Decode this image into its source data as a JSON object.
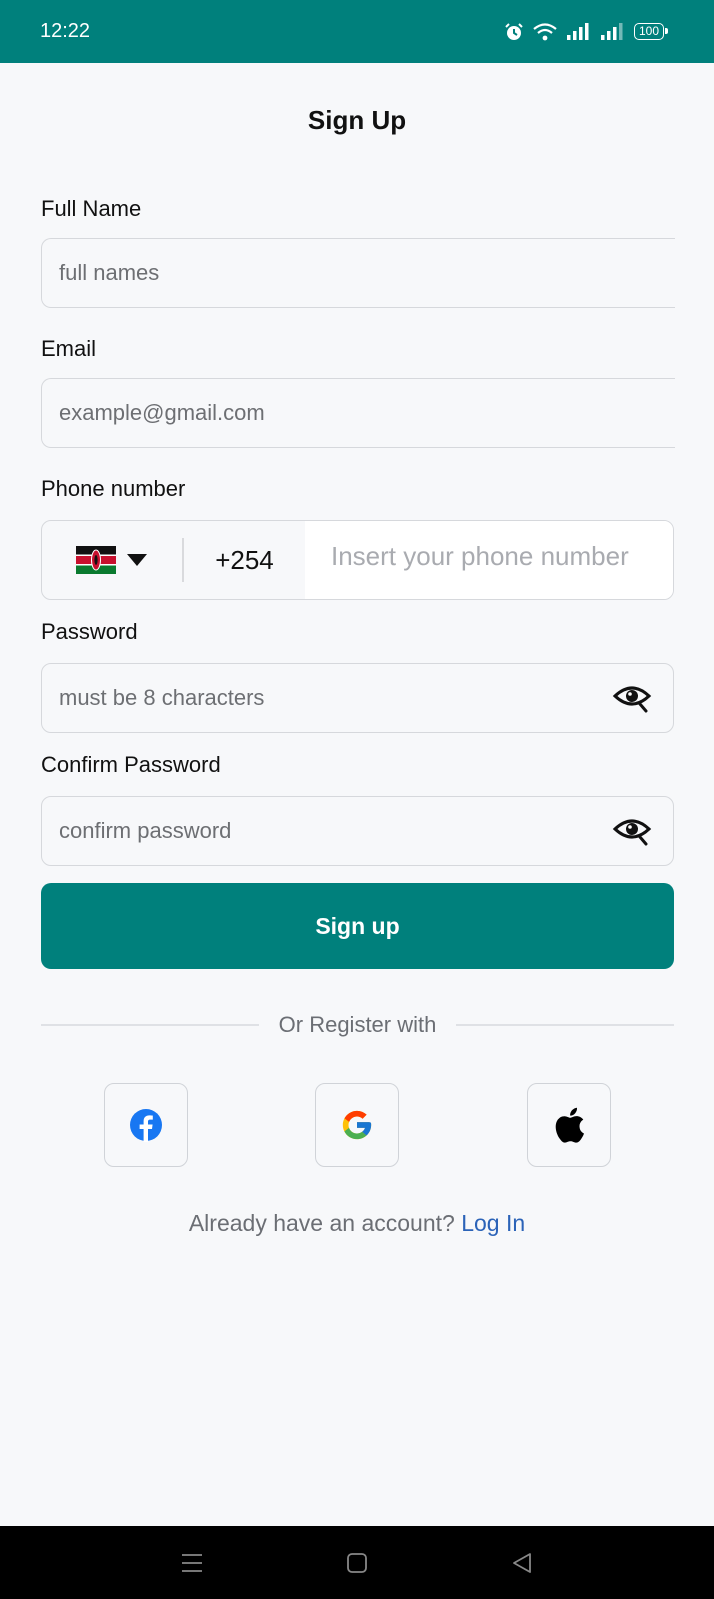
{
  "status_bar": {
    "time": "12:22",
    "battery": "100"
  },
  "page": {
    "title": "Sign Up"
  },
  "form": {
    "full_name": {
      "label": "Full Name",
      "placeholder": "full names"
    },
    "email": {
      "label": "Email",
      "placeholder": "example@gmail.com"
    },
    "phone": {
      "label": "Phone number",
      "country_flag": "kenya-flag",
      "dial_code": "+254",
      "placeholder": "Insert your phone number"
    },
    "password": {
      "label": "Password",
      "placeholder": "must be 8 characters"
    },
    "confirm_password": {
      "label": "Confirm Password",
      "placeholder": "confirm password"
    },
    "submit_label": "Sign up"
  },
  "social": {
    "divider_text": "Or Register with",
    "providers": [
      "facebook-icon",
      "google-icon",
      "apple-icon"
    ]
  },
  "footer": {
    "prompt": "Already have an account?",
    "link": "Log In"
  },
  "colors": {
    "brand": "#00807c",
    "link": "#2b63b8",
    "background": "#f7f8fa"
  }
}
